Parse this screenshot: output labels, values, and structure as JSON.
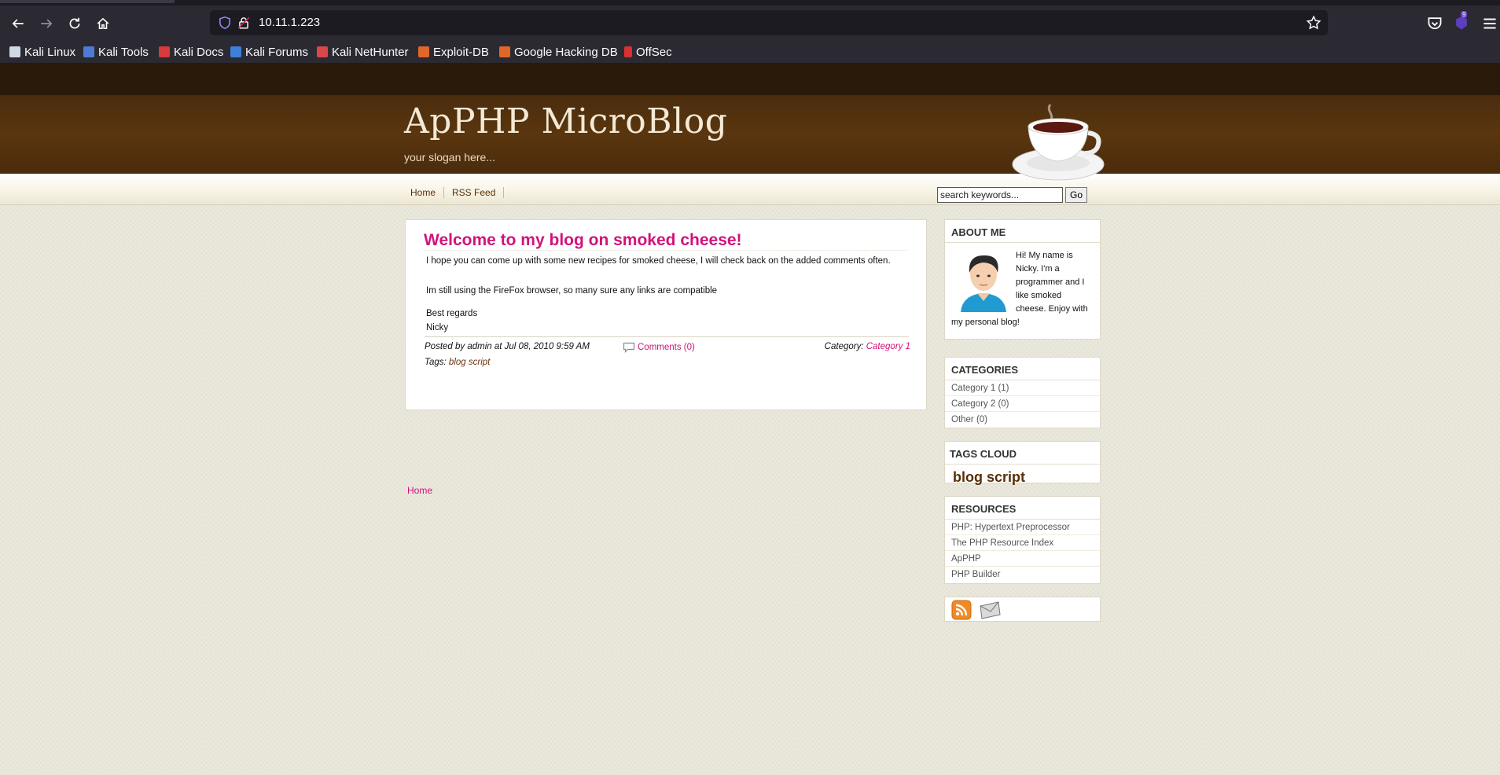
{
  "browser": {
    "url": "10.11.1.223",
    "extension_badge": "9",
    "bookmarks": [
      {
        "label": "Kali Linux",
        "icon": "kali-dragon-icon",
        "color": "#cfd8e3"
      },
      {
        "label": "Kali Tools",
        "icon": "kali-tools-icon",
        "color": "#4f7bd6"
      },
      {
        "label": "Kali Docs",
        "icon": "kali-docs-icon",
        "color": "#d53b3b"
      },
      {
        "label": "Kali Forums",
        "icon": "kali-forums-icon",
        "color": "#3d7fd9"
      },
      {
        "label": "Kali NetHunter",
        "icon": "nethunter-icon",
        "color": "#d94848"
      },
      {
        "label": "Exploit-DB",
        "icon": "exploitdb-icon",
        "color": "#e0662a"
      },
      {
        "label": "Google Hacking DB",
        "icon": "ghdb-icon",
        "color": "#e0662a"
      },
      {
        "label": "OffSec",
        "icon": "offsec-icon",
        "color": "#d93030"
      }
    ]
  },
  "site": {
    "title": "ApPHP MicroBlog",
    "slogan": "your slogan here...",
    "nav": [
      "Home",
      "RSS Feed"
    ],
    "search": {
      "value": "search keywords...",
      "button": "Go"
    }
  },
  "post": {
    "title": "Welcome to my blog on smoked cheese!",
    "paragraphs": [
      "I hope you can come up with some new recipes for smoked cheese, I will check back on the added comments often.",
      "Im still using the FireFox browser, so many sure any links are compatible",
      "Best regards",
      "Nicky"
    ],
    "meta": "Posted by admin at Jul 08, 2010 9:59 AM",
    "comments": "Comments (0)",
    "category_label": "Category:",
    "category_value": "Category 1",
    "tags_label": "Tags:",
    "tags_value": "blog script"
  },
  "footer": {
    "home": "Home"
  },
  "sidebar": {
    "about": {
      "title": "ABOUT ME",
      "text": "Hi! My name is Nicky. I'm a programmer and I like smoked cheese. Enjoy with my personal blog!"
    },
    "categories": {
      "title": "CATEGORIES",
      "items": [
        "Category 1 (1)",
        "Category 2 (0)",
        "Other (0)"
      ]
    },
    "tags": {
      "title": "TAGS CLOUD",
      "items": [
        "blog script"
      ]
    },
    "resources": {
      "title": "RESOURCES",
      "items": [
        "PHP: Hypertext Preprocessor",
        "The PHP Resource Index",
        "ApPHP",
        "PHP Builder"
      ]
    },
    "icons": [
      "rss-icon",
      "mail-icon"
    ]
  },
  "colors": {
    "accent_pink": "#d1137a",
    "header_brown": "#4a2c0d",
    "link_brown": "#5a2e06"
  }
}
